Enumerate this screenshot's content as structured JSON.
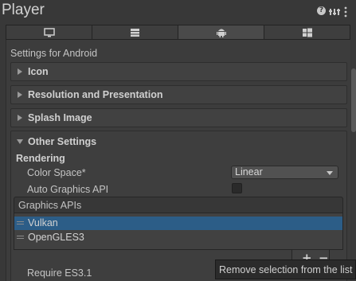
{
  "header": {
    "title": "Player",
    "icons": [
      "help-icon",
      "preset-icon",
      "kebab-menu-icon"
    ]
  },
  "tabs": [
    {
      "icon": "monitor-icon",
      "name": "Standalone",
      "active": false
    },
    {
      "icon": "server-icon",
      "name": "Dedicated Server",
      "active": false
    },
    {
      "icon": "android-icon",
      "name": "Android",
      "active": true
    },
    {
      "icon": "windows-icon",
      "name": "Universal Windows Platform",
      "active": false
    }
  ],
  "panel": {
    "subtitle": "Settings for Android",
    "sections": [
      {
        "label": "Icon",
        "expanded": false
      },
      {
        "label": "Resolution and Presentation",
        "expanded": false
      },
      {
        "label": "Splash Image",
        "expanded": false
      },
      {
        "label": "Other Settings",
        "expanded": true
      }
    ],
    "other_settings": {
      "rendering_heading": "Rendering",
      "color_space": {
        "label": "Color Space*",
        "value": "Linear"
      },
      "auto_graphics_api": {
        "label": "Auto Graphics API",
        "checked": false
      },
      "graphics_apis": {
        "header": "Graphics APIs",
        "items": [
          {
            "label": "Vulkan",
            "selected": true
          },
          {
            "label": "OpenGLES3",
            "selected": false
          }
        ],
        "add_label": "+",
        "remove_label": "−"
      },
      "require_es31": {
        "label": "Require ES3.1"
      }
    }
  },
  "tooltip": {
    "text": "Remove selection from the list"
  },
  "colors": {
    "background": "#383838",
    "panel": "#3c3c3c",
    "selection": "#2c5d87",
    "text": "#c4c4c4"
  }
}
